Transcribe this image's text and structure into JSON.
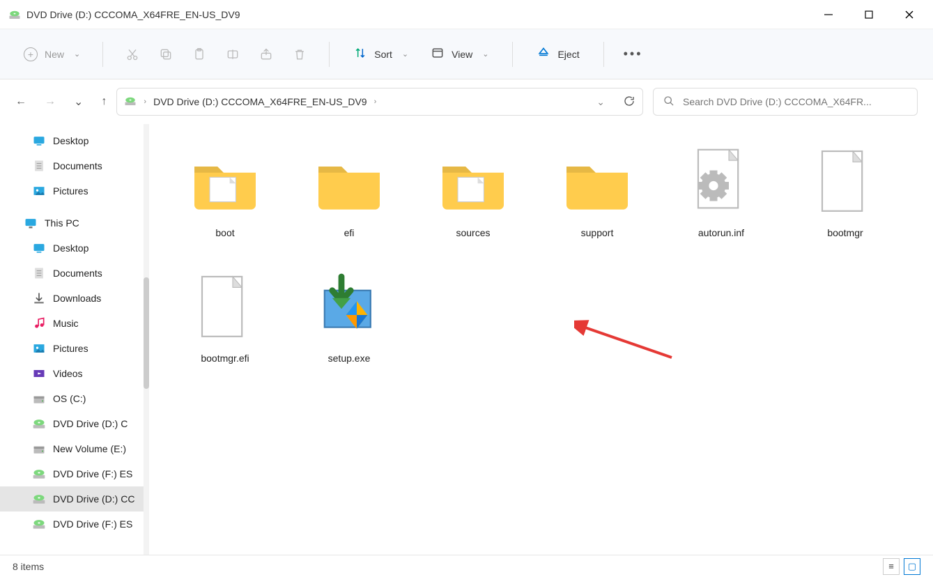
{
  "window": {
    "title": "DVD Drive (D:) CCCOMA_X64FRE_EN-US_DV9"
  },
  "toolbar": {
    "new_label": "New",
    "sort_label": "Sort",
    "view_label": "View",
    "eject_label": "Eject"
  },
  "address": {
    "crumb": "DVD Drive (D:) CCCOMA_X64FRE_EN-US_DV9"
  },
  "search": {
    "placeholder": "Search DVD Drive (D:) CCCOMA_X64FR..."
  },
  "sidebar": {
    "quick": [
      {
        "label": "Desktop",
        "icon": "desktop"
      },
      {
        "label": "Documents",
        "icon": "doc"
      },
      {
        "label": "Pictures",
        "icon": "pic"
      }
    ],
    "thispc_label": "This PC",
    "thispc": [
      {
        "label": "Desktop",
        "icon": "desktop"
      },
      {
        "label": "Documents",
        "icon": "doc"
      },
      {
        "label": "Downloads",
        "icon": "downloads"
      },
      {
        "label": "Music",
        "icon": "music"
      },
      {
        "label": "Pictures",
        "icon": "pic"
      },
      {
        "label": "Videos",
        "icon": "video"
      },
      {
        "label": "OS (C:)",
        "icon": "drive"
      },
      {
        "label": "DVD Drive (D:) C",
        "icon": "dvd"
      },
      {
        "label": "New Volume (E:)",
        "icon": "drive"
      },
      {
        "label": "DVD Drive (F:) ES",
        "icon": "dvd"
      },
      {
        "label": "DVD Drive (D:) CC",
        "icon": "dvd",
        "selected": true
      },
      {
        "label": "DVD Drive (F:) ES",
        "icon": "dvd"
      }
    ]
  },
  "files": [
    {
      "name": "boot",
      "type": "folder-doc"
    },
    {
      "name": "efi",
      "type": "folder"
    },
    {
      "name": "sources",
      "type": "folder-doc"
    },
    {
      "name": "support",
      "type": "folder"
    },
    {
      "name": "autorun.inf",
      "type": "gearfile"
    },
    {
      "name": "bootmgr",
      "type": "file"
    },
    {
      "name": "bootmgr.efi",
      "type": "file"
    },
    {
      "name": "setup.exe",
      "type": "setup"
    }
  ],
  "status": {
    "text": "8 items"
  }
}
